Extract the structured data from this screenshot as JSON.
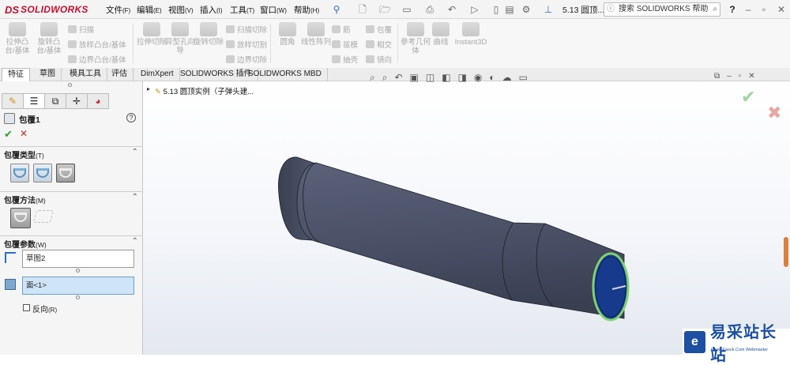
{
  "app": {
    "brand": "SOLIDWORKS",
    "brand_mark": "DS"
  },
  "menu": [
    {
      "label": "文件",
      "key": "(F)"
    },
    {
      "label": "编辑",
      "key": "(E)"
    },
    {
      "label": "视图",
      "key": "(V)"
    },
    {
      "label": "插入",
      "key": "(I)"
    },
    {
      "label": "工具",
      "key": "(T)"
    },
    {
      "label": "窗口",
      "key": "(W)"
    },
    {
      "label": "帮助",
      "key": "(H)"
    }
  ],
  "document_title": "5.13 圆顶...",
  "search": {
    "placeholder": "搜索 SOLIDWORKS 帮助"
  },
  "ribbon": {
    "extrude_boss": "拉伸凸台/基体",
    "revolve_boss": "旋转凸台/基体",
    "sweep": "扫描",
    "loft": "放样凸台/基体",
    "boundary": "边界凸台/基体",
    "extrude_cut": "拉伸切除",
    "hole_wizard": "异型孔向导",
    "revolve_cut": "旋转切除",
    "sweep_cut": "扫描切除",
    "loft_cut": "放样切割",
    "boundary_cut": "边界切除",
    "fillet": "圆角",
    "linear_pattern": "线性阵列",
    "rib": "筋",
    "draft": "拔模",
    "shell": "抽壳",
    "wrap": "包覆",
    "intersect": "相交",
    "mirror": "镜向",
    "ref_geometry": "参考几何体",
    "curves": "曲线",
    "instant3d": "Instant3D"
  },
  "tabs": [
    "特征",
    "草图",
    "模具工具",
    "评估",
    "DimXpert",
    "SOLIDWORKS 插件",
    "SOLIDWORKS MBD"
  ],
  "property_manager": {
    "title": "包覆1",
    "help": "?",
    "wrap_type": {
      "label": "包覆类型",
      "key": "(T)"
    },
    "wrap_method": {
      "label": "包覆方法",
      "key": "(M)"
    },
    "wrap_params": {
      "label": "包覆参数",
      "key": "(W)"
    },
    "sketch_field": "草图2",
    "face_field": "面<1>",
    "reverse": {
      "label": "反向",
      "key": "(R)"
    }
  },
  "tree": {
    "root": "5.13 圆顶实例（子弹头建..."
  },
  "watermark": {
    "text": "易采站长站",
    "sub": "Www.Easck.Com Webmaster"
  },
  "colors": {
    "accent_red": "#c8102e",
    "model_body": "#4a5166",
    "highlight_field": "#cfe4f7",
    "ok_green": "#2a9d2a",
    "cancel_red": "#c0302a"
  }
}
